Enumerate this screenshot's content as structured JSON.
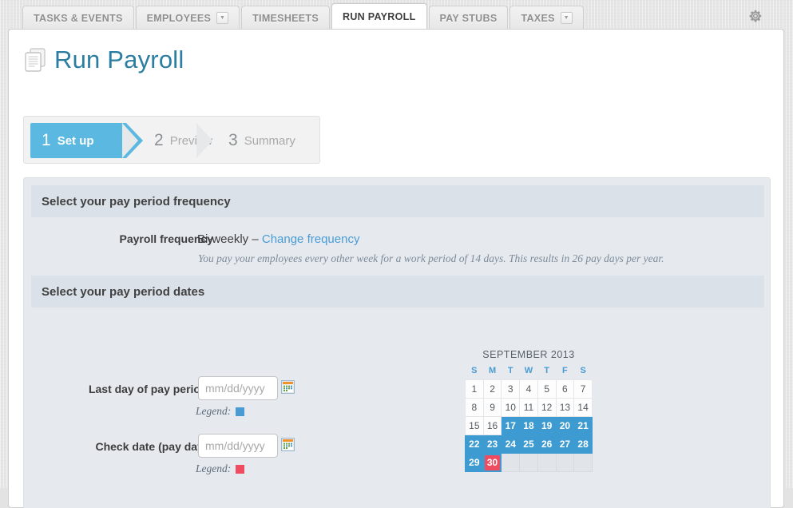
{
  "tabs": [
    {
      "label": "TASKS & EVENTS",
      "active": false,
      "caret": false
    },
    {
      "label": "EMPLOYEES",
      "active": false,
      "caret": true
    },
    {
      "label": "TIMESHEETS",
      "active": false,
      "caret": false
    },
    {
      "label": "RUN PAYROLL",
      "active": true,
      "caret": false
    },
    {
      "label": "PAY STUBS",
      "active": false,
      "caret": false
    },
    {
      "label": "TAXES",
      "active": false,
      "caret": true
    }
  ],
  "header": {
    "settings_icon": "gear-icon",
    "title": "Run Payroll",
    "title_icon": "documents-icon",
    "title_color": "#2b7ea1"
  },
  "steps": [
    {
      "num": "1",
      "label": "Set up",
      "active": true
    },
    {
      "num": "2",
      "label": "Preview",
      "active": false
    },
    {
      "num": "3",
      "label": "Summary",
      "active": false
    }
  ],
  "sections": {
    "frequency_heading": "Select your pay period frequency",
    "dates_heading": "Select your pay period dates"
  },
  "frequency": {
    "label": "Payroll frequency",
    "value": "Bi-weekly – ",
    "change_link": "Change frequency",
    "description": "You pay your employees every other week for a work period of 14 days. This results in 26 pay days per year."
  },
  "fields": [
    {
      "label": "Last day of pay period",
      "required": "*",
      "value": "",
      "placeholder": "mm/dd/yyyy",
      "calendar_icon": "calendar-picker-icon",
      "legend_label": "Legend:",
      "legend_color": "#4a9bd4"
    },
    {
      "label": "Check date (pay day)",
      "required": "*",
      "value": "",
      "placeholder": "mm/dd/yyyy",
      "calendar_icon": "calendar-picker-icon",
      "legend_label": "Legend:",
      "legend_color": "#ef4c62"
    }
  ],
  "calendar": {
    "title": "SEPTEMBER 2013",
    "weekdays": [
      "S",
      "M",
      "T",
      "W",
      "T",
      "F",
      "S"
    ],
    "weeks": [
      [
        {
          "day": "1",
          "state": "normal"
        },
        {
          "day": "2",
          "state": "normal"
        },
        {
          "day": "3",
          "state": "normal"
        },
        {
          "day": "4",
          "state": "normal"
        },
        {
          "day": "5",
          "state": "normal"
        },
        {
          "day": "6",
          "state": "normal"
        },
        {
          "day": "7",
          "state": "normal"
        }
      ],
      [
        {
          "day": "8",
          "state": "normal"
        },
        {
          "day": "9",
          "state": "normal"
        },
        {
          "day": "10",
          "state": "normal"
        },
        {
          "day": "11",
          "state": "normal"
        },
        {
          "day": "12",
          "state": "normal"
        },
        {
          "day": "13",
          "state": "normal"
        },
        {
          "day": "14",
          "state": "normal"
        }
      ],
      [
        {
          "day": "15",
          "state": "normal"
        },
        {
          "day": "16",
          "state": "normal"
        },
        {
          "day": "17",
          "state": "selected"
        },
        {
          "day": "18",
          "state": "selected"
        },
        {
          "day": "19",
          "state": "selected"
        },
        {
          "day": "20",
          "state": "selected"
        },
        {
          "day": "21",
          "state": "selected"
        }
      ],
      [
        {
          "day": "22",
          "state": "selected"
        },
        {
          "day": "23",
          "state": "selected"
        },
        {
          "day": "24",
          "state": "selected"
        },
        {
          "day": "25",
          "state": "selected"
        },
        {
          "day": "26",
          "state": "selected"
        },
        {
          "day": "27",
          "state": "selected"
        },
        {
          "day": "28",
          "state": "selected"
        }
      ],
      [
        {
          "day": "29",
          "state": "selected"
        },
        {
          "day": "30",
          "state": "payday"
        },
        {
          "day": "",
          "state": "blank"
        },
        {
          "day": "",
          "state": "blank"
        },
        {
          "day": "",
          "state": "blank"
        },
        {
          "day": "",
          "state": "blank"
        },
        {
          "day": "",
          "state": "blank"
        }
      ]
    ],
    "colors": {
      "selected": "#3e9bd1",
      "payday": "#ef4c62",
      "weekday_header": "#4a9bd4"
    }
  }
}
